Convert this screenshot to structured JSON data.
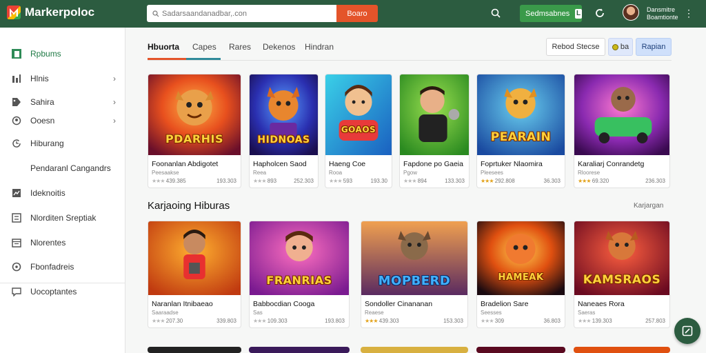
{
  "app": {
    "logo_text": "Markerpoloc"
  },
  "header": {
    "search_placeholder": "Sadarsaandanadbar,.con",
    "search_button": "Boaro",
    "cta_label": "Sedmsabnes",
    "cta_badge": "L",
    "user_name_line1": "Dansmitre",
    "user_name_line2": "Boamtionte"
  },
  "sidebar": {
    "items": [
      {
        "label": "Rpbums",
        "icon": "grid-icon",
        "chevron": false,
        "active": true
      },
      {
        "label": "Hlnis",
        "icon": "bars-icon",
        "chevron": true
      },
      {
        "label": "Sahira",
        "icon": "tag-icon",
        "chevron": true
      },
      {
        "label": "Ooesn",
        "icon": "user-icon",
        "chevron": true
      },
      {
        "label": "Hiburang",
        "icon": "history-icon",
        "chevron": false
      },
      {
        "label": "Pendaranl Cangandrs",
        "icon": "",
        "chevron": false
      },
      {
        "label": "Ideknoitis",
        "icon": "chart-icon",
        "chevron": false
      },
      {
        "label": "Nlorditen Sreptiak",
        "icon": "list-icon",
        "chevron": false
      },
      {
        "label": "Nlorentes",
        "icon": "calendar-icon",
        "chevron": false
      },
      {
        "label": "Fbonfadreis",
        "icon": "settings-icon",
        "chevron": false
      },
      {
        "label": "Uocoptantes",
        "icon": "chat-icon",
        "chevron": false
      }
    ]
  },
  "tabs": [
    "Hbuorta",
    "Capes",
    "Rares",
    "Dekenos",
    "Hindran"
  ],
  "filters": {
    "sort_label": "Rebod Stecse",
    "toggle_label": "ba",
    "action_label": "Rapian"
  },
  "section2": {
    "title": "Karjaoing Hiburas",
    "link": "Karjargan"
  },
  "colors": {
    "header": "#2c5c40",
    "accent": "#e4542a",
    "cta": "#3a9a4a"
  },
  "row1": [
    {
      "title": "Foonanlan Abdigotet",
      "sub": "Peesaakse",
      "stars": "★★★",
      "gold": false,
      "rating": "439.385",
      "price": "193.303",
      "thumb_text": "PDARHIS"
    },
    {
      "title": "Hapholcen Saod",
      "sub": "Reea",
      "stars": "★★★",
      "gold": false,
      "rating": "893",
      "price": "252.303",
      "thumb_text": "HIDNOAS"
    },
    {
      "title": "Haeng Coe",
      "sub": "Rooa",
      "stars": "★★★",
      "gold": false,
      "rating": "593",
      "price": "193.30",
      "thumb_text": "GOAOS"
    },
    {
      "title": "Fapdone po Gaeia",
      "sub": "Pgow",
      "stars": "★★★",
      "gold": false,
      "rating": "894",
      "price": "133.303",
      "thumb_text": ""
    },
    {
      "title": "Foprtuker Nlaomira",
      "sub": "Pleesees",
      "stars": "★★★",
      "gold": true,
      "rating": "292.808",
      "price": "36.303",
      "thumb_text": "PEARAIN"
    },
    {
      "title": "Karaliarj Conrandetg",
      "sub": "Rloorese",
      "stars": "★★★",
      "gold": true,
      "rating": "69.320",
      "price": "236.303",
      "thumb_text": ""
    }
  ],
  "row2": [
    {
      "title": "Naranlan Itnibaeao",
      "sub": "Saaraadse",
      "stars": "★★★",
      "gold": false,
      "rating": "207.30",
      "price": "339.803",
      "thumb_text": ""
    },
    {
      "title": "Babbocdian Cooga",
      "sub": "Sas",
      "stars": "★★★",
      "gold": false,
      "rating": "109.303",
      "price": "193.803",
      "thumb_text": "FRANRIAS"
    },
    {
      "title": "Sondoller Cinananan",
      "sub": "Reaese",
      "stars": "★★★",
      "gold": true,
      "rating": "439.303",
      "price": "153.303",
      "thumb_text": "MOPBERD"
    },
    {
      "title": "Bradelion Sare",
      "sub": "Seesses",
      "stars": "★★★",
      "gold": false,
      "rating": "309",
      "price": "36.803",
      "thumb_text": "HAMEAK"
    },
    {
      "title": "Naneaes Rora",
      "sub": "Saeras",
      "stars": "★★★",
      "gold": false,
      "rating": "139.303",
      "price": "257.803",
      "thumb_text": "KAMSRAOS"
    }
  ]
}
